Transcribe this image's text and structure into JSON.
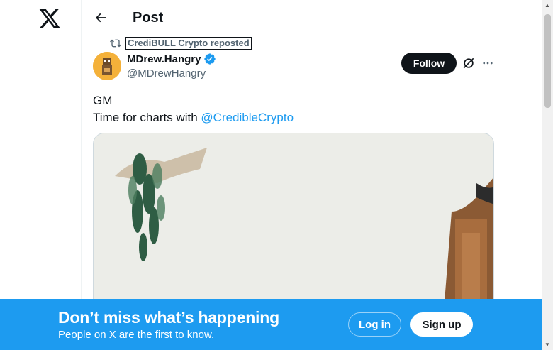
{
  "header": {
    "title": "Post"
  },
  "repost": {
    "label": "CrediBULL Crypto reposted"
  },
  "author": {
    "name": "MDrew.Hangry",
    "handle": "@MDrewHangry",
    "verified": true
  },
  "actions": {
    "follow_label": "Follow"
  },
  "tweet": {
    "line1": "GM",
    "line2_prefix": "Time for charts with ",
    "mention": "@CredibleCrypto"
  },
  "banner": {
    "title": "Don’t miss what’s happening",
    "subtitle": "People on X are the first to know.",
    "login_label": "Log in",
    "signup_label": "Sign up"
  },
  "colors": {
    "accent": "#1d9bf0",
    "text": "#0f1419",
    "muted": "#536471"
  },
  "icons": [
    "x-logo-icon",
    "back-arrow-icon",
    "repost-icon",
    "verified-badge-icon",
    "grok-icon",
    "more-icon"
  ]
}
